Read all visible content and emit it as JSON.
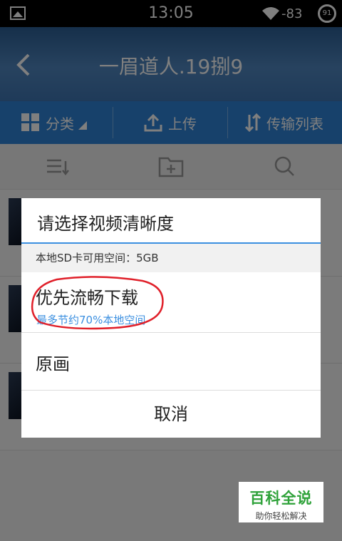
{
  "status_bar": {
    "time": "13:05",
    "signal": "-83",
    "battery": "91"
  },
  "header": {
    "title": "一眉道人.19捌9"
  },
  "action_bar": {
    "category": "分类",
    "upload": "上传",
    "transfer_list": "传输列表"
  },
  "dialog": {
    "title": "请选择视频清晰度",
    "space_info": "本地SD卡可用空间：5GB",
    "option_smooth": "优先流畅下载",
    "option_smooth_sub": "最多节约70%本地空间",
    "option_original": "原画",
    "cancel": "取消"
  },
  "watermark": {
    "main": "百科全说",
    "sub": "助你轻松解决"
  },
  "colors": {
    "accent": "#2f83d6",
    "dialog_line": "#3b8fe0",
    "highlight_circle": "#e0202a",
    "watermark_green": "#2fa23a"
  }
}
